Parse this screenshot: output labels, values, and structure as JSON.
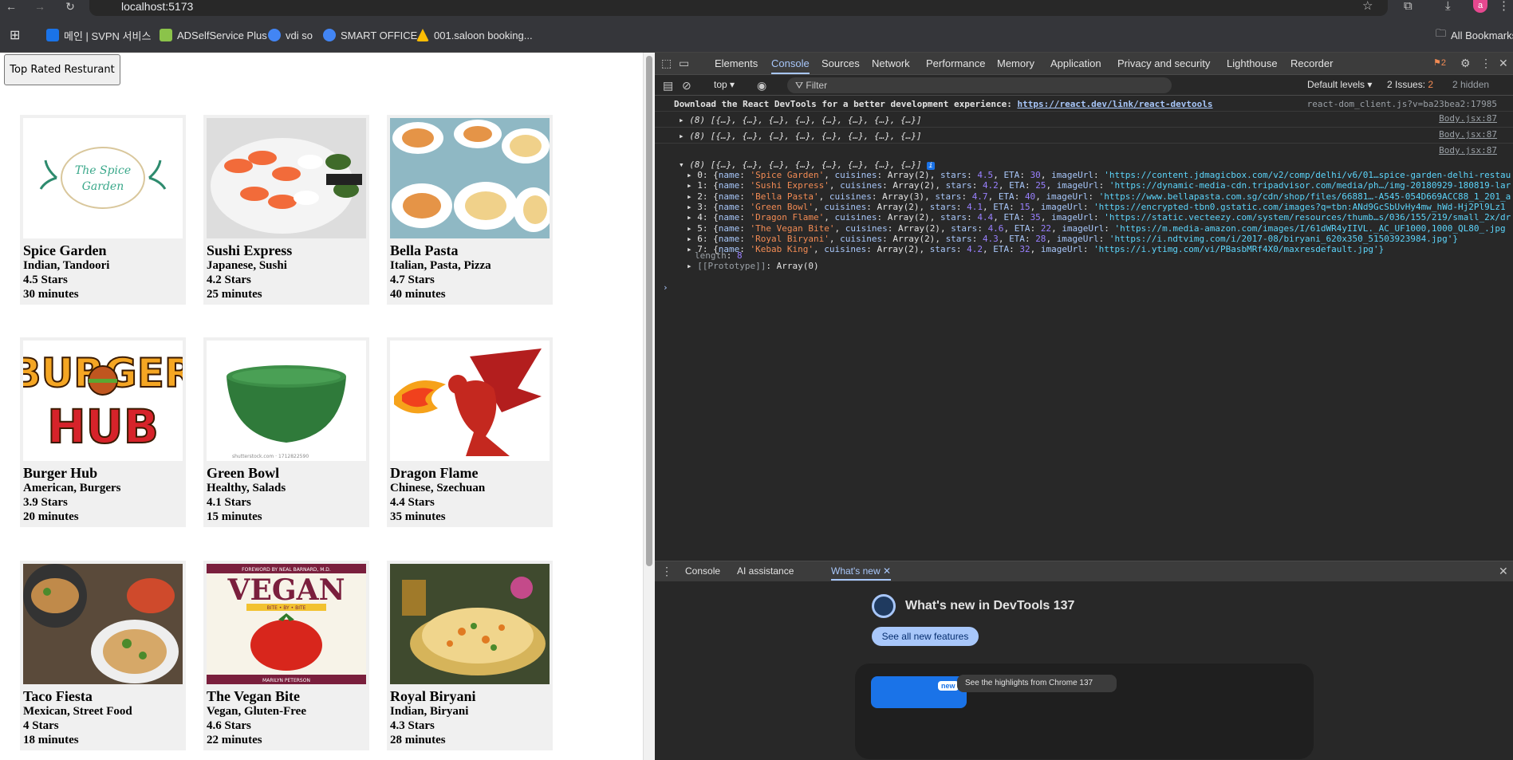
{
  "browser": {
    "url": "localhost:5173",
    "avatar_letter": "a",
    "bookmarks": [
      {
        "label": "메인 | SVPN 서비스",
        "color": "#1a73e8"
      },
      {
        "label": "ADSelfService Plus",
        "color": "#8bc34a"
      },
      {
        "label": "vdi so",
        "color": "#4285f4"
      },
      {
        "label": "SMART OFFICE",
        "color": "#4285f4"
      },
      {
        "label": "001.saloon booking...",
        "color": "#fbbc04"
      }
    ],
    "all_bookmarks": "All Bookmarks"
  },
  "page": {
    "top_button": "Top Rated Resturant",
    "restaurants": [
      {
        "name": "Spice Garden",
        "cuisines": "Indian, Tandoori",
        "stars": "4.5 Stars",
        "eta": "30 minutes",
        "img": "spice"
      },
      {
        "name": "Sushi Express",
        "cuisines": "Japanese, Sushi",
        "stars": "4.2 Stars",
        "eta": "25 minutes",
        "img": "sushi"
      },
      {
        "name": "Bella Pasta",
        "cuisines": "Italian, Pasta, Pizza",
        "stars": "4.7 Stars",
        "eta": "40 minutes",
        "img": "pasta"
      },
      {
        "name": "Burger Hub",
        "cuisines": "American, Burgers",
        "stars": "3.9 Stars",
        "eta": "20 minutes",
        "img": "burger"
      },
      {
        "name": "Green Bowl",
        "cuisines": "Healthy, Salads",
        "stars": "4.1 Stars",
        "eta": "15 minutes",
        "img": "bowl"
      },
      {
        "name": "Dragon Flame",
        "cuisines": "Chinese, Szechuan",
        "stars": "4.4 Stars",
        "eta": "35 minutes",
        "img": "dragon"
      },
      {
        "name": "Taco Fiesta",
        "cuisines": "Mexican, Street Food",
        "stars": "4 Stars",
        "eta": "18 minutes",
        "img": "taco"
      },
      {
        "name": "The Vegan Bite",
        "cuisines": "Vegan, Gluten-Free",
        "stars": "4.6 Stars",
        "eta": "22 minutes",
        "img": "vegan"
      },
      {
        "name": "Royal Biryani",
        "cuisines": "Indian, Biryani",
        "stars": "4.3 Stars",
        "eta": "28 minutes",
        "img": "biryani"
      }
    ],
    "logo_text": {
      "spice": "The Spice Garden",
      "burger_top": "BURGER",
      "burger_bottom": "HUB",
      "vegan": "VEGAN",
      "vegan_sub": "BITE • BY • BITE",
      "vegan_top": "FOREWORD BY NEAL BARNARD, M.D.",
      "vegan_author": "MARILYN PETERSON",
      "bowl_caption": "shutterstock.com · 1712822590"
    }
  },
  "devtools": {
    "tabs": [
      "Elements",
      "Console",
      "Sources",
      "Network",
      "Performance",
      "Memory",
      "Application",
      "Privacy and security",
      "Lighthouse",
      "Recorder"
    ],
    "active_tab": "Console",
    "issue_badge": "2",
    "context": "top",
    "filter_placeholder": "Filter",
    "levels": "Default levels",
    "issues": "2 Issues:",
    "issues_count": "2",
    "hidden": "2 hidden",
    "messages": {
      "react_prefix": "Download the React DevTools for a better development experience: ",
      "react_link": "https://react.dev/link/react-devtools",
      "react_src": "react-dom_client.js?v=ba23bea2:17985",
      "array_summary": "(8) [{…}, {…}, {…}, {…}, {…}, {…}, {…}, {…}]",
      "src": "Body.jsx:87",
      "items": [
        {
          "idx": "0",
          "name": "'Spice Garden'",
          "cuisines": "Array(2)",
          "stars": "4.5",
          "eta": "30",
          "url": "'https://content.jdmagicbox.com/v2/comp/delhi/v6/01…spice-garden-delhi-restau"
        },
        {
          "idx": "1",
          "name": "'Sushi Express'",
          "cuisines": "Array(2)",
          "stars": "4.2",
          "eta": "25",
          "url": "'https://dynamic-media-cdn.tripadvisor.com/media/ph…/img-20180929-180819-lar"
        },
        {
          "idx": "2",
          "name": "'Bella Pasta'",
          "cuisines": "Array(3)",
          "stars": "4.7",
          "eta": "40",
          "url": "'https://www.bellapasta.com.sg/cdn/shop/files/66881…-A545-054D669ACC88_1_201_a"
        },
        {
          "idx": "3",
          "name": "'Green Bowl'",
          "cuisines": "Array(2)",
          "stars": "4.1",
          "eta": "15",
          "url": "'https://encrypted-tbn0.gstatic.com/images?q=tbn:ANd9GcSbUvHy4mw_hWd-Hj2Pl9Lz1"
        },
        {
          "idx": "4",
          "name": "'Dragon Flame'",
          "cuisines": "Array(2)",
          "stars": "4.4",
          "eta": "35",
          "url": "'https://static.vecteezy.com/system/resources/thumb…s/036/155/219/small_2x/dr"
        },
        {
          "idx": "5",
          "name": "'The Vegan Bite'",
          "cuisines": "Array(2)",
          "stars": "4.6",
          "eta": "22",
          "url": "'https://m.media-amazon.com/images/I/61dWR4yIIVL._AC_UF1000,1000_QL80_.jpg"
        },
        {
          "idx": "6",
          "name": "'Royal Biryani'",
          "cuisines": "Array(2)",
          "stars": "4.3",
          "eta": "28",
          "url": "'https://i.ndtvimg.com/i/2017-08/biryani_620x350_51503923984.jpg'}"
        },
        {
          "idx": "7",
          "name": "'Kebab King'",
          "cuisines": "Array(2)",
          "stars": "4.2",
          "eta": "32",
          "url": "'https://i.ytimg.com/vi/PBasbMRf4X0/maxresdefault.jpg'}"
        }
      ],
      "length_label": "length",
      "length_value": "8",
      "prototype": "[[Prototype]]",
      "prototype_value": "Array(0)"
    },
    "drawer": {
      "tabs": [
        "Console",
        "AI assistance",
        "What's new"
      ],
      "title": "What's new in DevTools 137",
      "button": "See all new features",
      "card_badge": "new",
      "card_text": "See the highlights from Chrome 137"
    }
  }
}
